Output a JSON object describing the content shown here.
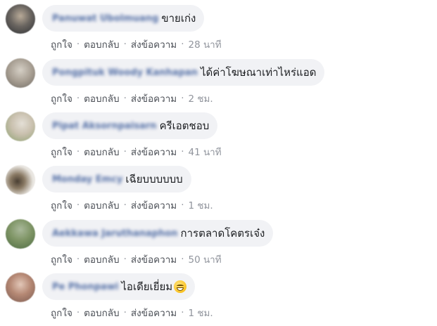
{
  "comments": [
    {
      "author": "Panuwat Ubolmuang",
      "text": "ขายเก่ง",
      "emoji": false,
      "actions": {
        "like": "ถูกใจ",
        "reply": "ตอบกลับ",
        "message": "ส่งข้อความ"
      },
      "time": "28 นาที",
      "avatar_colors": [
        "#2d2f33",
        "#6a6560",
        "#b8aa98"
      ]
    },
    {
      "author": "Pongpituk Woody Kanhapan",
      "text": "ได้ค่าโฆษณาเท่าไหร่แอด",
      "emoji": false,
      "actions": {
        "like": "ถูกใจ",
        "reply": "ตอบกลับ",
        "message": "ส่งข้อความ"
      },
      "time": "2 ชม.",
      "avatar_colors": [
        "#6f6a63",
        "#a79e92",
        "#d5cfc5"
      ]
    },
    {
      "author": "Pipat Aksornpaisarn",
      "text": "ครีเอตชอบ",
      "emoji": false,
      "actions": {
        "like": "ถูกใจ",
        "reply": "ตอบกลับ",
        "message": "ส่งข้อความ"
      },
      "time": "41 นาที",
      "avatar_colors": [
        "#8aa06e",
        "#c9c0ae",
        "#e4dfd6"
      ]
    },
    {
      "author": "Monday Emcy",
      "text": "เฉียบบบบบบ",
      "emoji": false,
      "actions": {
        "like": "ถูกใจ",
        "reply": "ตอบกลับ",
        "message": "ส่งข้อความ"
      },
      "time": "1 ชม.",
      "avatar_colors": [
        "#e9e6e1",
        "#8a7a64",
        "#4a3f33"
      ]
    },
    {
      "author": "Aekkawa Jaruthanaphon",
      "text": "การตลาดโคตรเจ๋ง",
      "emoji": false,
      "actions": {
        "like": "ถูกใจ",
        "reply": "ตอบกลับ",
        "message": "ส่งข้อความ"
      },
      "time": "50 นาที",
      "avatar_colors": [
        "#4d6b42",
        "#7f9566",
        "#a9b89a"
      ]
    },
    {
      "author": "Pe Phonpawi",
      "text": "ไอเดียเยี่ยม",
      "emoji": true,
      "actions": {
        "like": "ถูกใจ",
        "reply": "ตอบกลับ",
        "message": "ส่งข้อความ"
      },
      "time": "1 ชม.",
      "avatar_colors": [
        "#7a5a50",
        "#b58874",
        "#e2c7b8"
      ]
    }
  ]
}
